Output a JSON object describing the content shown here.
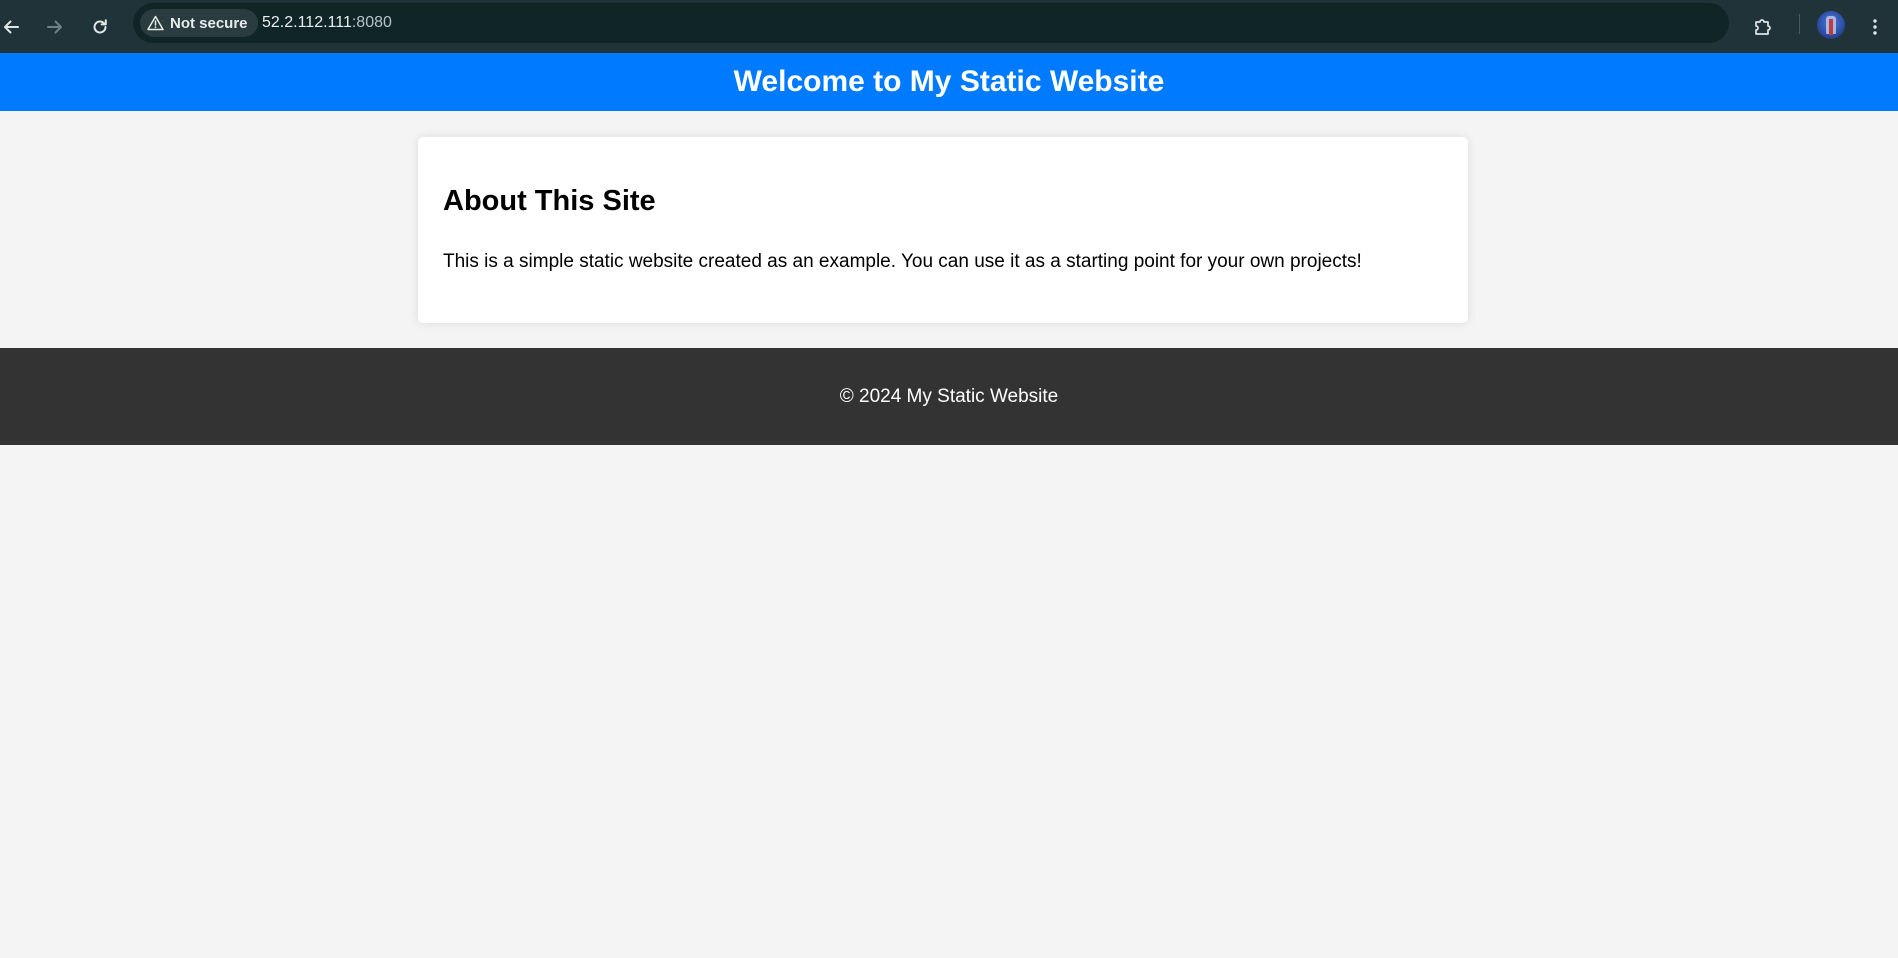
{
  "browser": {
    "security_label": "Not secure",
    "url_host": "52.2.112.111",
    "url_port": ":8080",
    "icons": {
      "back": "back-arrow-icon",
      "forward": "forward-arrow-icon",
      "reload": "reload-icon",
      "warning": "warning-triangle-icon",
      "bookmark": "star-icon",
      "extensions": "puzzle-icon",
      "menu": "kebab-menu-icon"
    },
    "colors": {
      "toolbar": "#1f3338",
      "omnibox": "#0f2526"
    }
  },
  "page": {
    "header_title": "Welcome to My Static Website",
    "section_title": "About This Site",
    "section_text": "This is a simple static website created as an example. You can use it as a starting point for your own projects!",
    "footer_text": "© 2024 My Static Website",
    "colors": {
      "header_bg": "#007bff",
      "page_bg": "#f4f4f4",
      "card_bg": "#ffffff",
      "footer_bg": "#333333"
    }
  }
}
